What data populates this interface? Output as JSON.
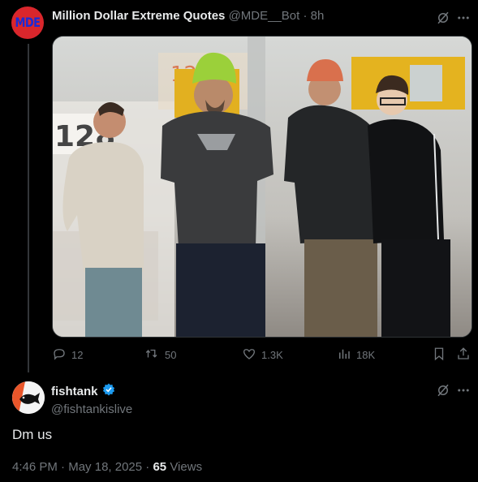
{
  "tweet1": {
    "author_name": "Million Dollar Extreme Quotes",
    "handle": "@MDE__Bot",
    "separator": "·",
    "time": "8h",
    "avatar_text": "MDE",
    "photo_signs": {
      "street_number": "128",
      "overhead_sign": "12"
    },
    "actions": {
      "replies": "12",
      "reposts": "50",
      "likes": "1.3K",
      "views": "18K"
    }
  },
  "tweet2": {
    "author_name": "fishtank",
    "handle": "@fishtankislive",
    "text": "Dm us",
    "time": "4:46 PM",
    "separator": "·",
    "date": "May 18, 2025",
    "separator2": "·",
    "views_count": "65",
    "views_label": "Views"
  },
  "colors": {
    "background": "#000000",
    "text": "#e7e9ea",
    "muted": "#71767b",
    "verified": "#1d9bf0"
  },
  "icons": [
    "grok-icon",
    "more-icon",
    "reply-icon",
    "repost-icon",
    "like-icon",
    "views-icon",
    "bookmark-icon",
    "share-icon",
    "verified-badge-icon"
  ]
}
